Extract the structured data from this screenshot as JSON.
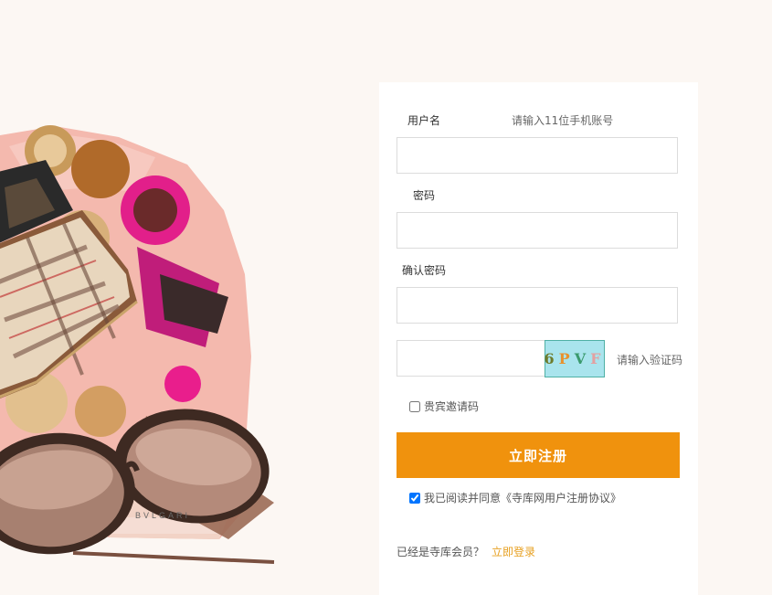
{
  "form": {
    "username_label": "用户名",
    "username_hint": "请输入11位手机账号",
    "username_value": "",
    "password_label": "密码",
    "password_value": "",
    "confirm_label": "确认密码",
    "confirm_value": "",
    "captcha_value": "",
    "captcha_chars": [
      "6",
      "P",
      "V",
      "F"
    ],
    "captcha_hint": "请输入验证码",
    "invite_label": "贵宾邀请码",
    "invite_checked": false,
    "submit_label": "立即注册",
    "agreement_label": "我已阅读并同意《寺库网用户注册协议》",
    "agreement_checked": true,
    "member_prompt": "已经是寺库会员？",
    "login_link": "立即登录"
  },
  "hero": {
    "brand_text": "BVLGARI"
  },
  "colors": {
    "page_bg": "#fcf7f3",
    "accent": "#f0920d",
    "link": "#e7a021",
    "captcha_bg": "#a9e4ed"
  }
}
